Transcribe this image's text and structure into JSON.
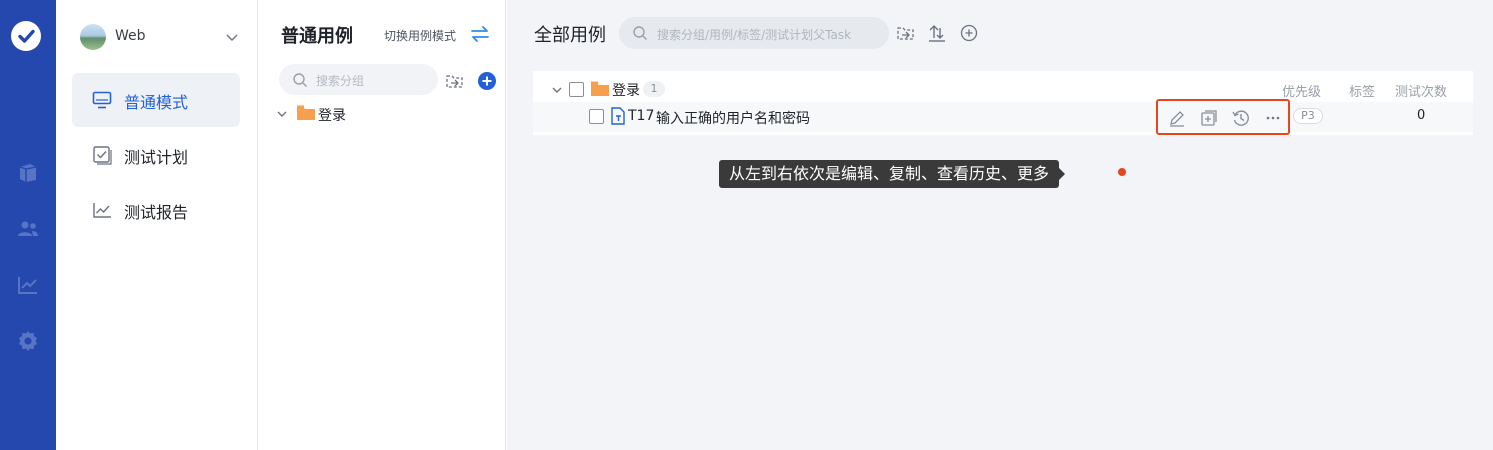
{
  "project": {
    "name": "Web"
  },
  "nav": {
    "items": [
      {
        "label": "普通模式",
        "icon": "monitor-icon",
        "active": true
      },
      {
        "label": "测试计划",
        "icon": "checklist-icon",
        "active": false
      },
      {
        "label": "测试报告",
        "icon": "trend-chart-icon",
        "active": false
      }
    ]
  },
  "tree": {
    "title": "普通用例",
    "switch_label": "切换用例模式",
    "search_placeholder": "搜索分组",
    "nodes": [
      {
        "label": "登录"
      }
    ]
  },
  "main": {
    "title": "全部用例",
    "search_placeholder": "搜索分组/用例/标签/测试计划父Task",
    "columns": {
      "priority": "优先级",
      "tags": "标签",
      "runs": "测试次数"
    },
    "group": {
      "label": "登录",
      "count": "1"
    },
    "case": {
      "id": "T17",
      "title": "输入正确的用户名和密码",
      "priority": "P3",
      "runs": "0"
    },
    "tooltip": "从左到右依次是编辑、复制、查看历史、更多"
  },
  "colors": {
    "rail": "#2448ad",
    "accent": "#2360d8",
    "highlight": "#e8441e",
    "folder": "#f6a04d"
  }
}
